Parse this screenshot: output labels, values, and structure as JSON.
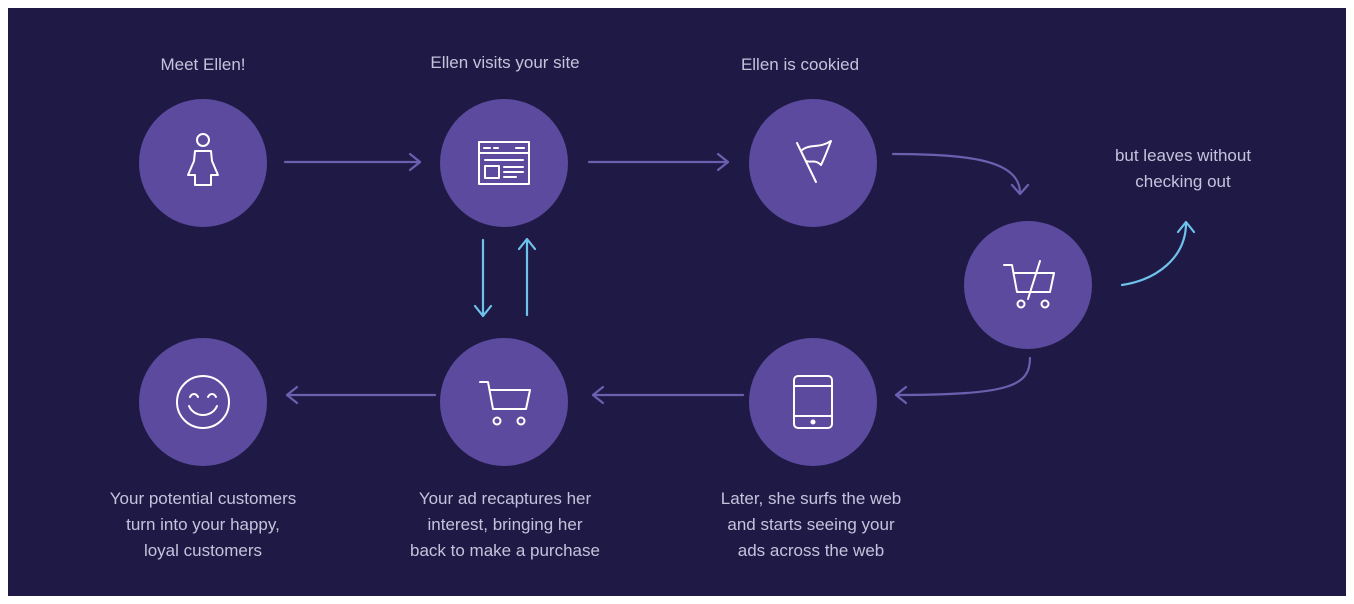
{
  "colors": {
    "background": "#1f1a45",
    "node_fill": "#5c4a9e",
    "arrow_purple": "#6c5fb0",
    "arrow_blue": "#6fc2ec",
    "label_text": "#c5c2dc",
    "icon_stroke": "#ffffff"
  },
  "steps": {
    "meet": {
      "label": "Meet Ellen!",
      "icon": "person-icon"
    },
    "visits": {
      "label": "Ellen visits your site",
      "icon": "browser-window-icon"
    },
    "cookied": {
      "label": "Ellen is cookied",
      "icon": "flag-icon"
    },
    "leaves": {
      "label": "but leaves without\nchecking out",
      "icon": "abandoned-cart-icon"
    },
    "ads": {
      "label": "Later, she surfs the web\nand starts seeing your\nads across the web",
      "icon": "tablet-icon"
    },
    "recapture": {
      "label": "Your ad recaptures her\ninterest, bringing her\nback to make a purchase",
      "icon": "shopping-cart-icon"
    },
    "happy": {
      "label": "Your potential customers\nturn into your happy,\nloyal  customers",
      "icon": "smiley-icon"
    }
  }
}
